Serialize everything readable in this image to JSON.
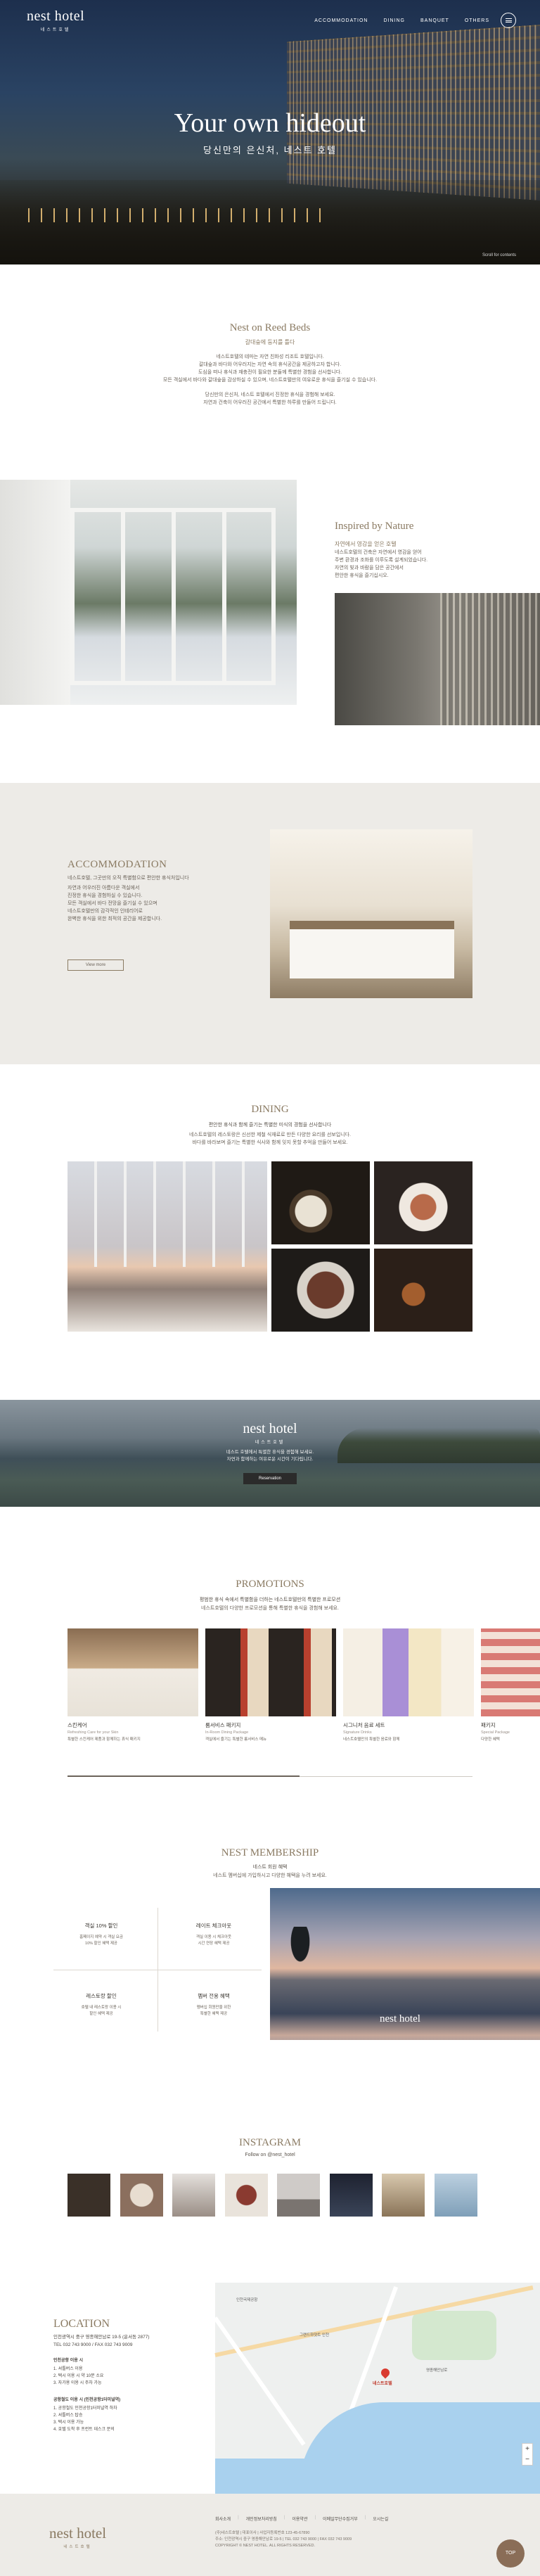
{
  "header": {
    "logo": "nest hotel",
    "logo_sub": "네스트호텔",
    "nav": [
      "ACCOMMODATION",
      "DINING",
      "BANQUET",
      "OTHERS"
    ]
  },
  "hero": {
    "title": "Your own hideout",
    "subtitle": "당신만의 은신처, 네스트 호텔",
    "scroll_hint": "Scroll for contents"
  },
  "intro": {
    "title": "Nest on Reed Beds",
    "subtitle": "갈대숲에 둥지를 틀다",
    "lines": [
      "네스트호텔의 테마는 자연 친화성 리조트 호텔입니다.",
      "갈대숲과 바다와 어우러지는 자연 속의 휴식공간을 제공하고자 합니다.",
      "도심을 떠나 휴식과 재충전이 필요한 분들께 특별한 경험을 선사합니다.",
      "모든 객실에서 바다와 갈대숲을 감상하실 수 있으며, 네스트호텔만의 여유로운 휴식을 즐기실 수 있습니다."
    ],
    "lines2": [
      "당신만의 은신처, 네스트 호텔에서 진정한 휴식을 경험해 보세요.",
      "자연과 건축이 어우러진 공간에서 특별한 하루를 만들어 드립니다."
    ]
  },
  "nature": {
    "title": "Inspired by Nature",
    "subtitle": "자연에서 영감을 얻은 호텔",
    "lines": [
      "네스트호텔의 건축은 자연에서 영감을 얻어",
      "주변 환경과 조화를 이루도록 설계되었습니다.",
      "자연의 빛과 바람을 담은 공간에서",
      "편안한 휴식을 즐기십시오."
    ]
  },
  "accommodation": {
    "title": "ACCOMMODATION",
    "subtitle": "네스트호텔, 그곳만의 오직 특별함으로 편안한 휴식처입니다",
    "lines": [
      "자연과 어우러진 아름다운 객실에서",
      "진정한 휴식을 경험하실 수 있습니다.",
      "모든 객실에서 바다 전망을 즐기실 수 있으며",
      "네스트호텔만의 감각적인 인테리어로",
      "완벽한 휴식을 위한 최적의 공간을 제공합니다."
    ],
    "button": "View more"
  },
  "dining": {
    "title": "DINING",
    "subtitle": "편안한 휴식과 함께 즐기는 특별한 미식의 경험을 선사합니다",
    "lines": [
      "네스트호텔의 레스토랑은 신선한 제철 식재료로 만든 다양한 요리를 선보입니다.",
      "바다를 바라보며 즐기는 특별한 식사와 함께 잊지 못할 추억을 만들어 보세요."
    ]
  },
  "banner": {
    "logo": "nest hotel",
    "logo_sub": "네스트호텔",
    "lines": [
      "네스트 호텔에서 특별한 휴식을 경험해 보세요.",
      "자연과 함께하는 여유로운 시간이 기다립니다."
    ],
    "button": "Reservation"
  },
  "promotions": {
    "title": "PROMOTIONS",
    "subtitle": "평범한 휴식 속에서 특별함을 더하는 네스트호텔만의 특별한 프로모션",
    "line": "네스트호텔의 다양한 프로모션을 통해 특별한 휴식을 경험해 보세요.",
    "cards": [
      {
        "title": "스킨케어",
        "en": "Refreshing Care for your Skin",
        "desc": "특별한 스킨케어 제품과 함께하는 휴식 패키지"
      },
      {
        "title": "룸서비스 패키지",
        "en": "In-Room Dining Package",
        "desc": "객실에서 즐기는 특별한 룸서비스 메뉴"
      },
      {
        "title": "시그니처 음료 세트",
        "en": "Signature Drinks",
        "desc": "네스트호텔만의 특별한 음료와 함께"
      },
      {
        "title": "패키지",
        "en": "Special Package",
        "desc": "다양한 혜택"
      }
    ]
  },
  "membership": {
    "title": "NEST MEMBERSHIP",
    "subtitle": "네스트 회원 혜택",
    "line": "네스트 멤버십에 가입하시고 다양한 혜택을 누려 보세요.",
    "cells": [
      {
        "title": "객실 10% 할인",
        "desc": [
          "홈페이지 예약 시 객실 요금",
          "10% 할인 혜택 제공"
        ]
      },
      {
        "title": "레이트 체크아웃",
        "desc": [
          "객실 이용 시 체크아웃",
          "시간 연장 혜택 제공"
        ]
      },
      {
        "title": "레스토랑 할인",
        "desc": [
          "호텔 내 레스토랑 이용 시",
          "할인 혜택 제공"
        ]
      },
      {
        "title": "멤버 전용 혜택",
        "desc": [
          "멤버십 회원만을 위한",
          "특별한 혜택 제공"
        ]
      }
    ],
    "image_logo": "nest hotel"
  },
  "instagram": {
    "title": "INSTAGRAM",
    "follow": "Follow on @nest_hotel",
    "colors": [
      "#3a3028",
      "#b8a898",
      "#9a8e86",
      "#8a3a30",
      "#b9b4b0",
      "#2a2e3a",
      "#c8b49a",
      "#9fb7cc"
    ]
  },
  "location": {
    "title": "LOCATION",
    "address": "인천광역시 중구 영종해안남로 19-5 (운서동 2877)",
    "tel": "TEL 032 743 9000 / FAX 032 743 9009",
    "airport_title": "인천공항 이용 시",
    "airport_lines": [
      "1. 셔틀버스 이용",
      "2. 택시 이용 시 약 10분 소요",
      "3. 자가용 이용 시 주차 가능"
    ],
    "shuttle_title": "공항철도 이용 시 (인천공항1터미널역)",
    "shuttle_lines": [
      "1. 공항철도 인천공항1터미널역 하차",
      "2. 셔틀버스 탑승",
      "3. 택시 이용 가능",
      "4. 호텔 도착 후 프런트 데스크 문의"
    ],
    "map_pin": "네스트호텔",
    "map_labels": [
      "인천국제공항",
      "영종해안남로",
      "그랜드하얏트 인천"
    ]
  },
  "footer": {
    "logo": "nest hotel",
    "logo_sub": "네스트호텔",
    "links": [
      "회사소개",
      "개인정보처리방침",
      "이용약관",
      "이메일무단수집거부",
      "오시는길"
    ],
    "info": [
      "(주)네스트호텔 | 대표이사 | 사업자등록번호 123-45-67890",
      "주소: 인천광역시 중구 영종해안남로 19-5 | TEL 032 743 9000 | FAX 032 743 9009",
      "COPYRIGHT © NEST HOTEL. ALL RIGHTS RESERVED."
    ],
    "top_button": "TOP"
  }
}
